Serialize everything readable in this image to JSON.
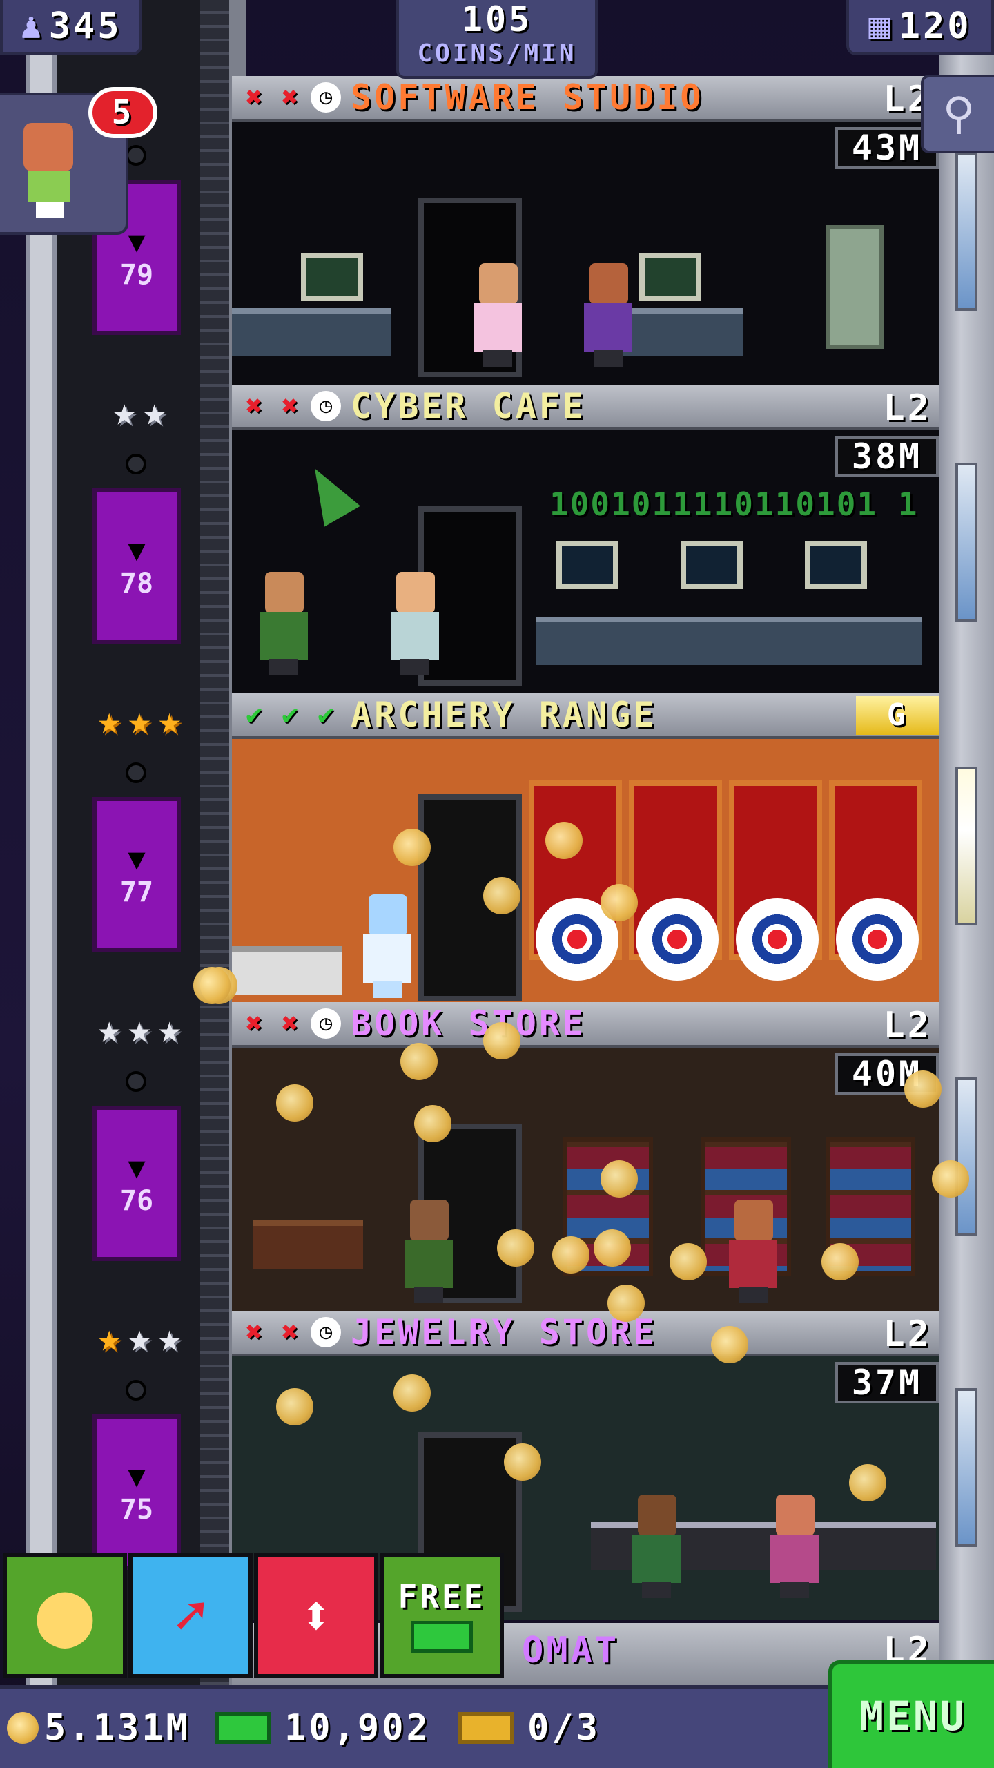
{
  "hud": {
    "population": "345",
    "coins_per_min": "105",
    "coins_per_min_unit": "COINS/MIN",
    "floors_count": "120",
    "notifications": "5"
  },
  "elevator": [
    {
      "floor": "79",
      "stars": [
        "silver",
        "silver",
        "silver"
      ]
    },
    {
      "floor": "78",
      "stars": [
        "silver",
        "silver"
      ]
    },
    {
      "floor": "77",
      "stars": [
        "gold",
        "gold",
        "gold"
      ]
    },
    {
      "floor": "76",
      "stars": [
        "silver",
        "silver",
        "silver"
      ]
    },
    {
      "floor": "75",
      "stars": [
        "gold",
        "silver",
        "silver"
      ]
    }
  ],
  "floors": [
    {
      "name": "SOFTWARE STUDIO",
      "level": "L2",
      "timer": "43M",
      "name_color": "#ff7a33",
      "status": [
        "x",
        "x",
        "clock"
      ]
    },
    {
      "name": "CYBER CAFE",
      "level": "L2",
      "timer": "38M",
      "name_color": "#f3eea0",
      "status": [
        "x",
        "x",
        "clock"
      ],
      "decor_text": "1001011110110101 1"
    },
    {
      "name": "ARCHERY RANGE",
      "level": "G",
      "timer": "",
      "name_color": "#f3eea0",
      "status": [
        "ok",
        "ok",
        "ok"
      ]
    },
    {
      "name": "BOOK STORE",
      "level": "L2",
      "timer": "40M",
      "name_color": "#e58bff",
      "status": [
        "x",
        "x",
        "clock"
      ]
    },
    {
      "name": "JEWELRY STORE",
      "level": "L2",
      "timer": "37M",
      "name_color": "#e58bff",
      "status": [
        "x",
        "x",
        "clock"
      ]
    }
  ],
  "next_floor": {
    "name_fragment": "OMAT",
    "level": "L2"
  },
  "actions": {
    "free_label": "FREE"
  },
  "currency": {
    "coins": "5.131M",
    "bux": "10,902",
    "vip": "0/3"
  },
  "menu_label": "MENU",
  "colors": {
    "elevator": "#8b14b3",
    "accent_green": "#2ec63a",
    "hud_bg": "#45467a"
  },
  "icons": [
    "person-icon",
    "floors-icon",
    "search-icon",
    "x-icon",
    "check-icon",
    "clock-icon",
    "star-icon",
    "coins-icon",
    "build-arrow-icon",
    "elevator-updown-icon",
    "bux-icon",
    "vip-ticket-icon"
  ]
}
